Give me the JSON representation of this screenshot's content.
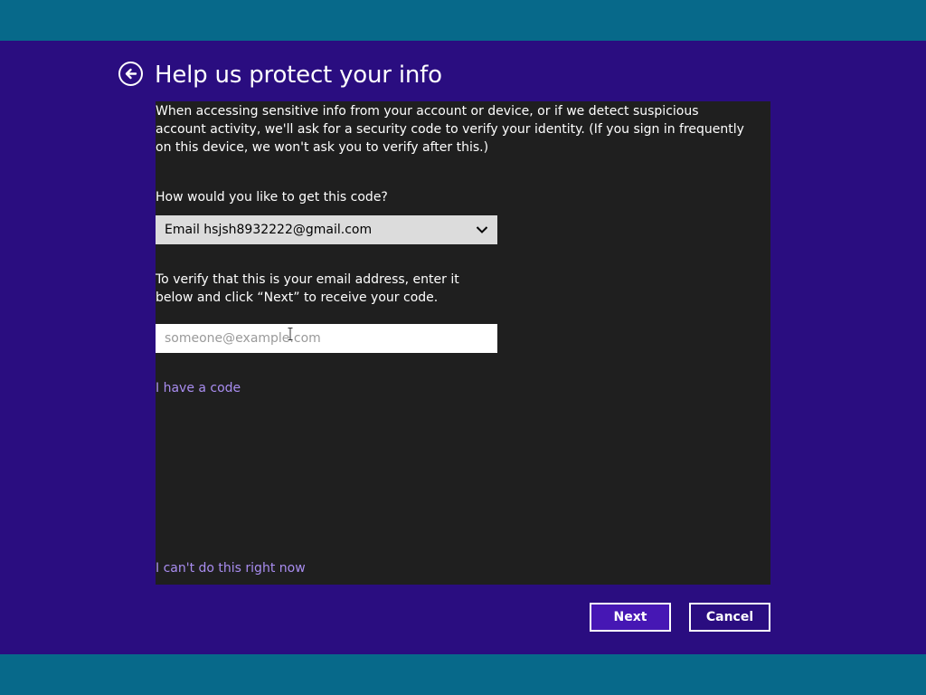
{
  "header": {
    "title": "Help us protect your info",
    "back_icon": "back-arrow-circle-icon"
  },
  "content": {
    "intro": "When accessing sensitive info from your account or device, or if we detect suspicious account activity, we'll ask for a security code to verify your identity. (If you sign in frequently on this device, we won't ask you to verify after this.)",
    "question": "How would you like to get this code?",
    "method_dropdown": {
      "selected": "Email hsjsh8932222@gmail.com",
      "icon": "chevron-down-icon"
    },
    "verify_text": "To verify that this is your email address, enter it below and click “Next” to receive your code.",
    "email_input": {
      "value": "",
      "placeholder": "someone@example.com"
    },
    "have_code_link": "I have a code",
    "cant_do_link": "I can't do this right now"
  },
  "buttons": {
    "next": "Next",
    "cancel": "Cancel"
  },
  "colors": {
    "background": "#2a0d80",
    "band": "#07698a",
    "panel": "#1f1f1f",
    "link": "#a98df0",
    "next_button": "#4617b4"
  }
}
